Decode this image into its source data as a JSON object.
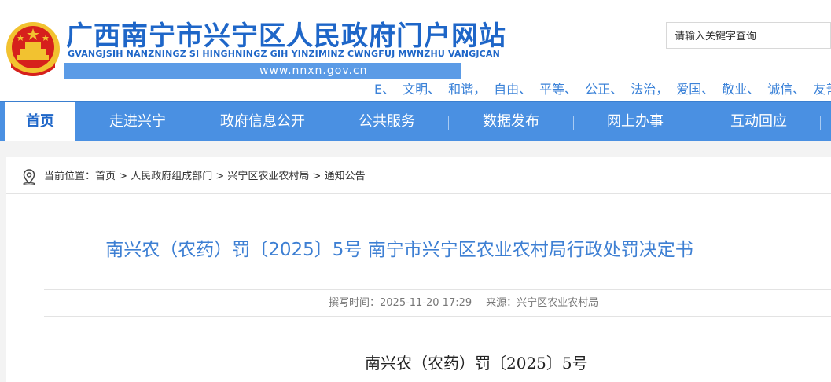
{
  "header": {
    "site_title": "广西南宁市兴宁区人民政府门户网站",
    "site_pinyin": "GVANGJSIH NANZNINGZ SI HINGHNINGZ GIH YINZIMINZ CWNGFUJ MWNZHU VANGJCAN",
    "site_url": "www.nnxn.gov.cn",
    "search_placeholder": "请输入关键字查询",
    "core_values": [
      "E、",
      "文明、",
      "和谐，",
      "自由、",
      "平等、",
      "公正、",
      "法治，",
      "爱国、",
      "敬业、",
      "诚信、",
      "友善"
    ]
  },
  "nav": {
    "items": [
      {
        "label": "首页"
      },
      {
        "label": "走进兴宁"
      },
      {
        "label": "政府信息公开"
      },
      {
        "label": "公共服务"
      },
      {
        "label": "数据发布"
      },
      {
        "label": "网上办事"
      },
      {
        "label": "互动回应"
      }
    ]
  },
  "breadcrumb": {
    "prefix": "当前位置：",
    "items": [
      "首页",
      "人民政府组成部门",
      "兴宁区农业农村局",
      "通知公告"
    ],
    "separator": " > "
  },
  "article": {
    "title": "南兴农（农药）罚〔2025〕5号 南宁市兴宁区农业农村局行政处罚决定书",
    "meta_time": "撰写时间：2025-11-20 17:29",
    "meta_source": "来源：兴宁区农业农村局",
    "doc_number": "南兴农（农药）罚〔2025〕5号"
  },
  "colors": {
    "brand_blue": "#1e66c8",
    "nav_blue": "#4a90e2",
    "title_blue": "#3d7fd3",
    "emblem_red": "#d6201c",
    "emblem_gold": "#f2c230"
  }
}
